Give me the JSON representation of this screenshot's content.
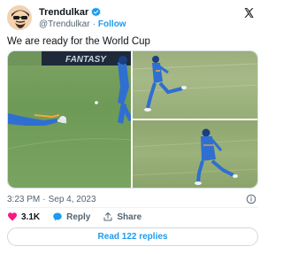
{
  "author": {
    "display_name": "Trendulkar",
    "handle": "@Trendulkar",
    "separator": "·",
    "follow_label": "Follow",
    "verified": true
  },
  "tweet": {
    "text": "We are ready for the World Cup"
  },
  "media": {
    "count": 3,
    "banner_text": "FANTASY"
  },
  "meta": {
    "time": "3:23 PM",
    "separator": "·",
    "date": "Sep 4, 2023"
  },
  "actions": {
    "likes": "3.1K",
    "reply_label": "Reply",
    "share_label": "Share"
  },
  "read_replies_label": "Read 122 replies",
  "colors": {
    "accent": "#1d9bf0",
    "like": "#f91880",
    "muted": "#536471"
  }
}
